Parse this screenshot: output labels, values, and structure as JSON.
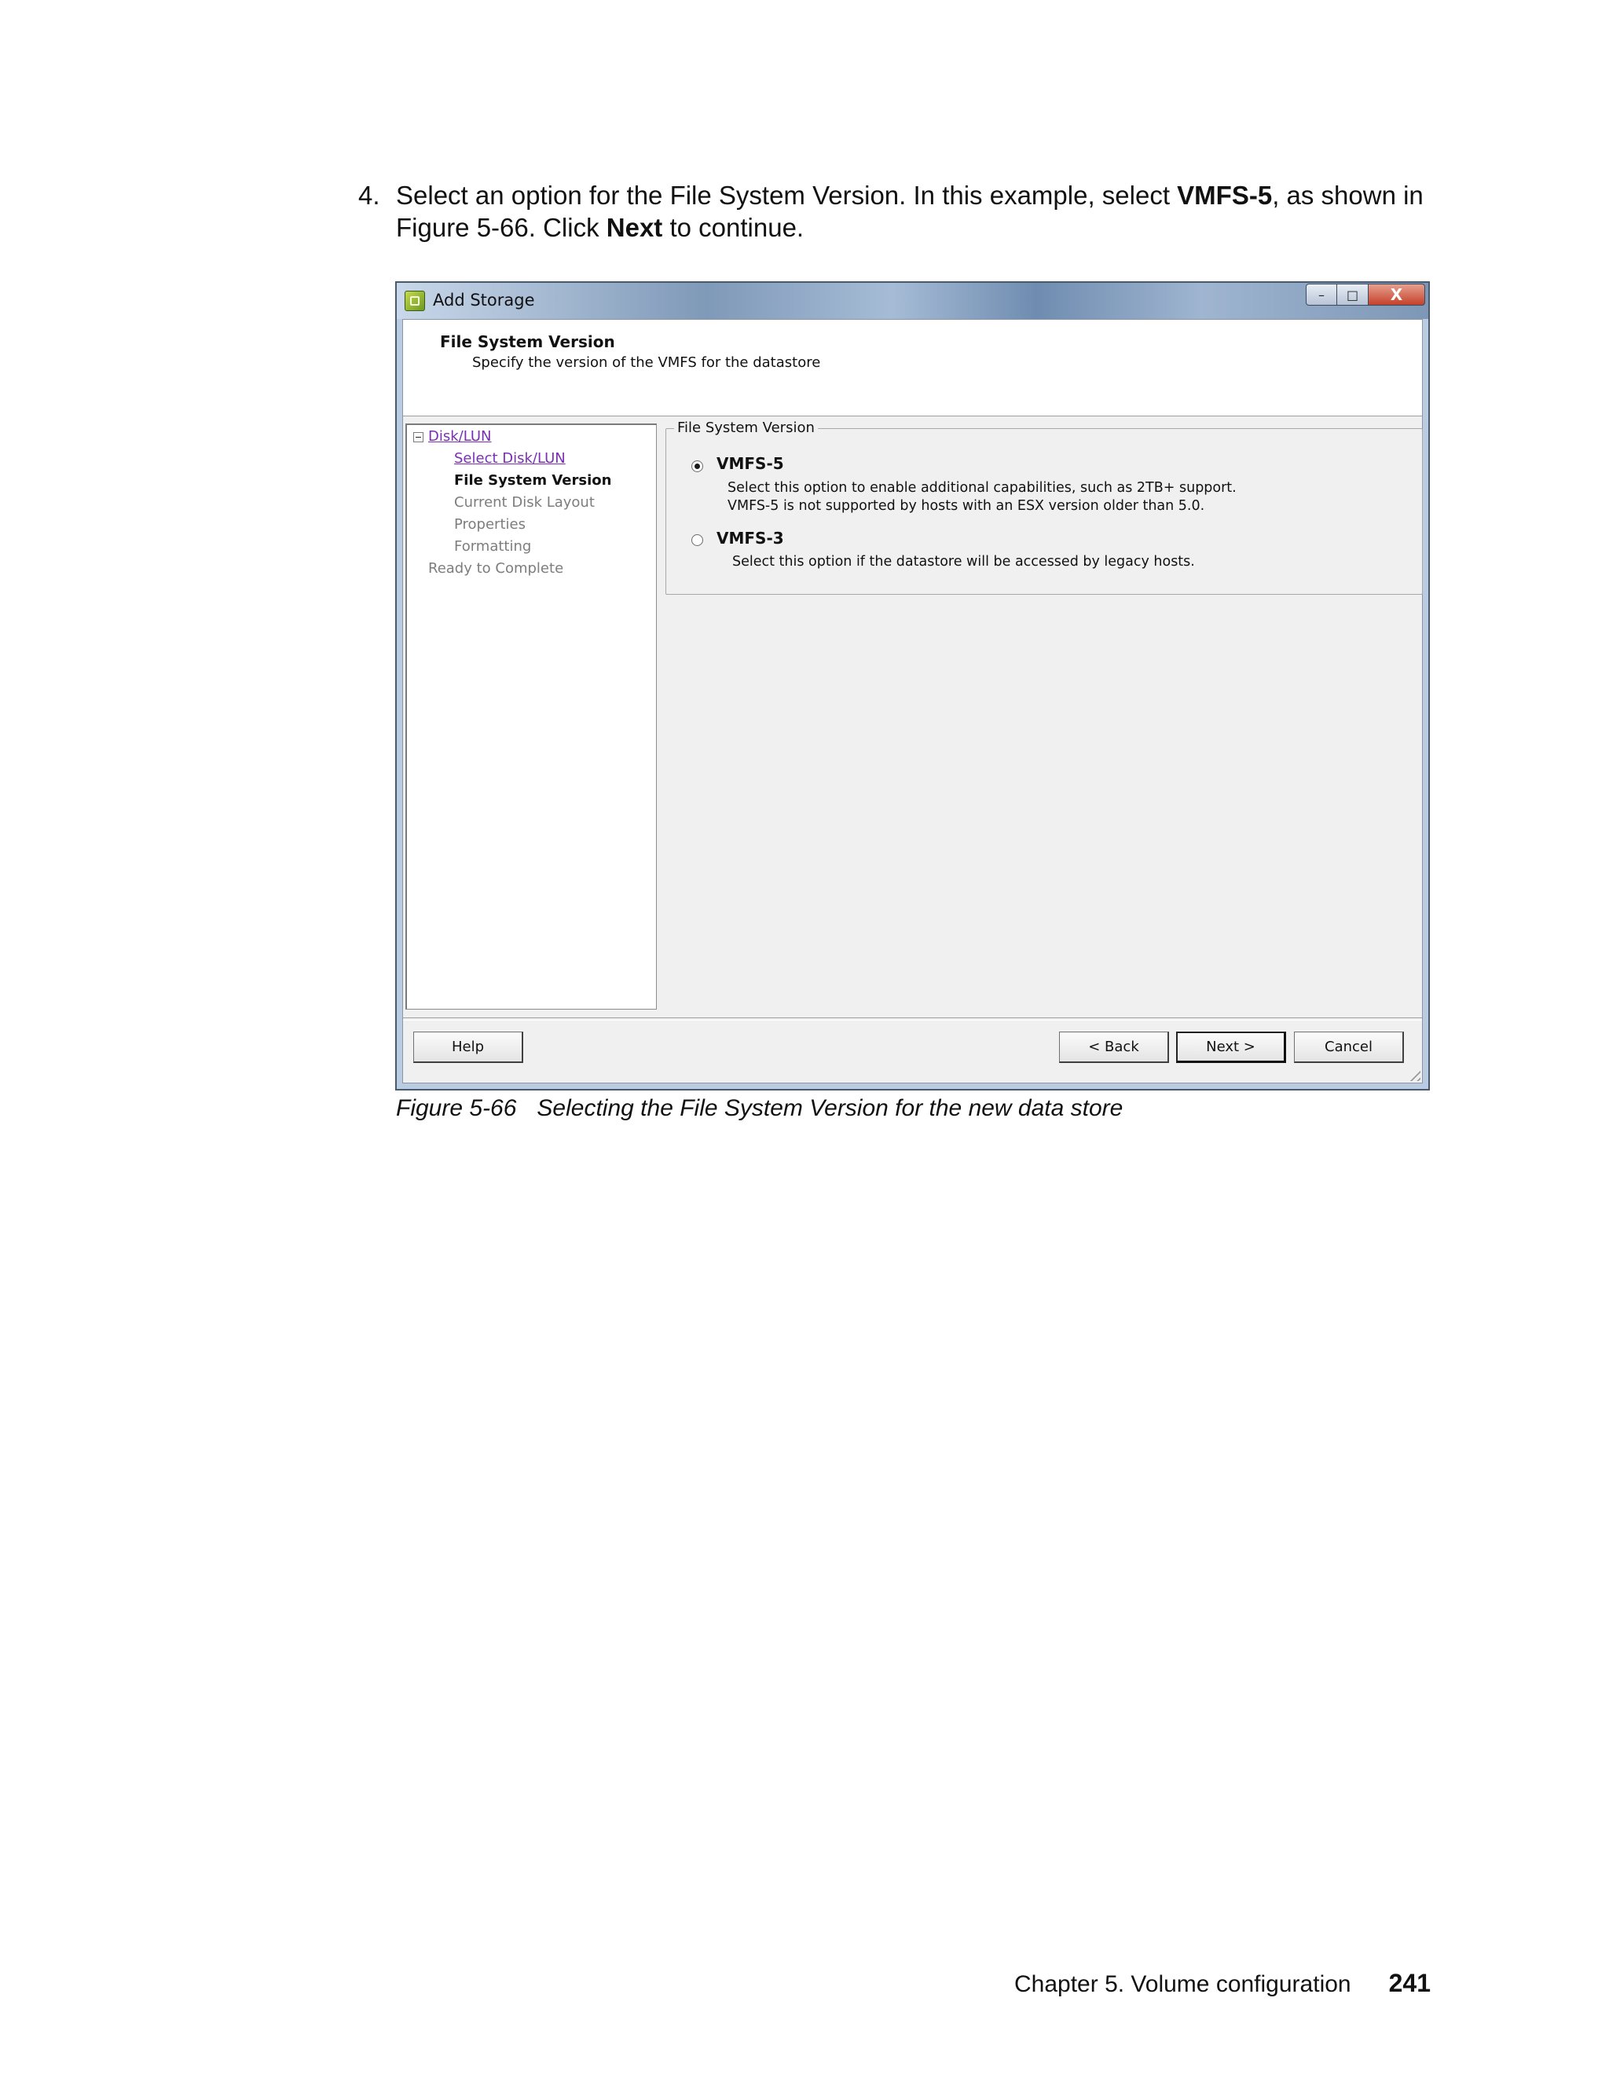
{
  "step": {
    "number": "4.",
    "line1_pre": "Select an option for the File System Version. In this example, select ",
    "line1_bold": "VMFS-5",
    "line1_post": ", as shown in",
    "line2_pre": "Figure 5-66. Click ",
    "line2_bold": "Next",
    "line2_post": " to continue."
  },
  "window": {
    "title": "Add Storage",
    "controls": {
      "minimize": "–",
      "maximize": "□",
      "close": "X"
    },
    "header": {
      "title": "File System Version",
      "subtitle": "Specify the version of the VMFS for the datastore"
    },
    "nav": {
      "items": [
        {
          "label": "Disk/LUN",
          "state": "link"
        },
        {
          "label": "Select Disk/LUN",
          "state": "link"
        },
        {
          "label": "File System Version",
          "state": "current"
        },
        {
          "label": "Current Disk Layout",
          "state": "pending"
        },
        {
          "label": "Properties",
          "state": "pending"
        },
        {
          "label": "Formatting",
          "state": "pending"
        },
        {
          "label": "Ready to Complete",
          "state": "pending"
        }
      ]
    },
    "group": {
      "legend": "File System Version",
      "options": [
        {
          "label": "VMFS-5",
          "selected": true,
          "desc1": "Select this option to enable additional capabilities, such as 2TB+ support.",
          "desc2": "VMFS-5 is not supported by hosts with an ESX version older than 5.0."
        },
        {
          "label": "VMFS-3",
          "selected": false,
          "desc1": "Select this option if the datastore will be accessed by legacy hosts."
        }
      ]
    },
    "buttons": {
      "help": "Help",
      "back": "< Back",
      "next": "Next >",
      "cancel": "Cancel"
    }
  },
  "caption": {
    "label": "Figure 5-66",
    "text": "Selecting the File System Version for the new data store"
  },
  "footer": {
    "chapter": "Chapter 5. Volume configuration",
    "page": "241"
  },
  "colors": {
    "link": "#7a2fb5",
    "pending": "#7d7d7d",
    "dialog_bg": "#f0f0f0"
  }
}
